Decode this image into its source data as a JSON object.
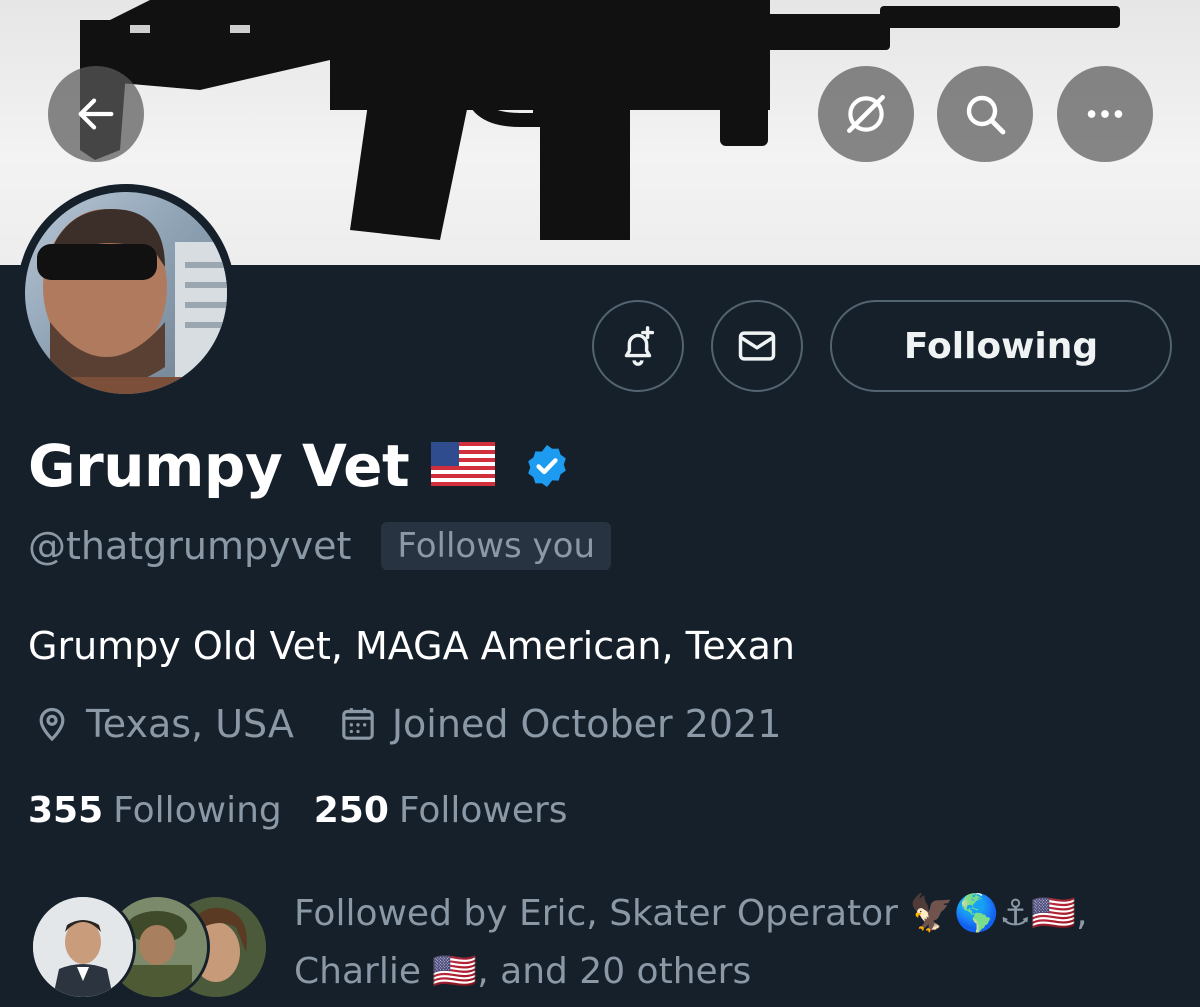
{
  "header": {
    "back_icon": "arrow-left-icon",
    "grok_icon": "grok-slash-icon",
    "search_icon": "search-icon",
    "more_icon": "more-horizontal-icon"
  },
  "profile": {
    "display_name": "Grumpy Vet",
    "name_flag": "🇺🇸",
    "verified": true,
    "handle": "@thatgrumpyvet",
    "follows_you_label": "Follows you",
    "bio": "Grumpy Old Vet, MAGA American, Texan",
    "location": "Texas, USA",
    "joined": "Joined October 2021"
  },
  "actions": {
    "notify_icon": "bell-plus-icon",
    "message_icon": "envelope-icon",
    "following_label": "Following"
  },
  "stats": {
    "following_count": "355",
    "following_label": "Following",
    "followers_count": "250",
    "followers_label": "Followers"
  },
  "followed_by": {
    "prefix": "Followed by Eric, Skater Operator ",
    "emojis_1": "🦅🌎⚓",
    "flag_a": "🇺🇸",
    "sep_charlie": ", Charlie ",
    "flag_b": "🇺🇸",
    "suffix": ", and 20 others"
  },
  "colors": {
    "background": "#15202b",
    "secondary_text": "#8b98a5",
    "border": "#536471",
    "verified_blue": "#1d9bf0"
  }
}
